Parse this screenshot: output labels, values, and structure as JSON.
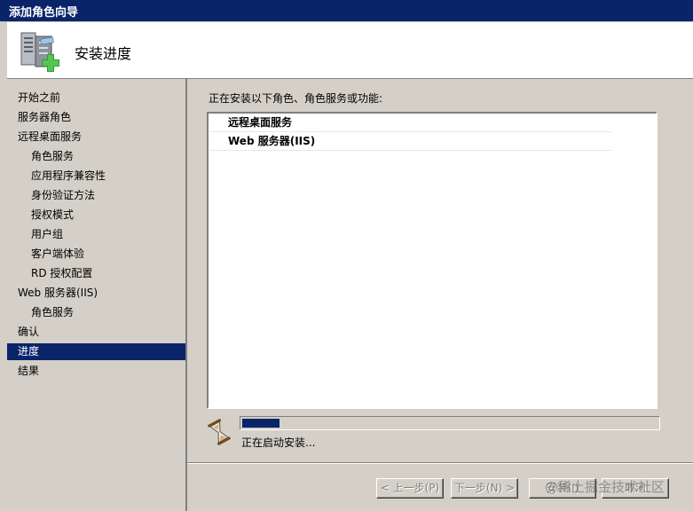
{
  "window": {
    "title": "添加角色向导",
    "accent": "#0a246a",
    "face": "#d4d0c8"
  },
  "header": {
    "title": "安装进度",
    "icon": "server-add-icon"
  },
  "nav": {
    "items": [
      {
        "label": "开始之前",
        "level": 1,
        "active": false
      },
      {
        "label": "服务器角色",
        "level": 1,
        "active": false
      },
      {
        "label": "远程桌面服务",
        "level": 1,
        "active": false
      },
      {
        "label": "角色服务",
        "level": 2,
        "active": false
      },
      {
        "label": "应用程序兼容性",
        "level": 2,
        "active": false
      },
      {
        "label": "身份验证方法",
        "level": 2,
        "active": false
      },
      {
        "label": "授权模式",
        "level": 2,
        "active": false
      },
      {
        "label": "用户组",
        "level": 2,
        "active": false
      },
      {
        "label": "客户端体验",
        "level": 2,
        "active": false
      },
      {
        "label": "RD 授权配置",
        "level": 2,
        "active": false
      },
      {
        "label": "Web 服务器(IIS)",
        "level": 1,
        "active": false
      },
      {
        "label": "角色服务",
        "level": 2,
        "active": false
      },
      {
        "label": "确认",
        "level": 1,
        "active": false
      },
      {
        "label": "进度",
        "level": 1,
        "active": true
      },
      {
        "label": "结果",
        "level": 1,
        "active": false
      }
    ]
  },
  "main": {
    "label": "正在安装以下角色、角色服务或功能:",
    "list": [
      "远程桌面服务",
      "Web 服务器(IIS)"
    ],
    "progress_fraction": 0.09,
    "status": "正在启动安装...",
    "status_icon": "hourglass-icon"
  },
  "footer": {
    "prev_label": "< 上一步(P)",
    "next_label": "下一步(N) >",
    "install_label": "安装(I)",
    "cancel_label": "取消"
  },
  "watermark": "@稀土掘金技术社区"
}
